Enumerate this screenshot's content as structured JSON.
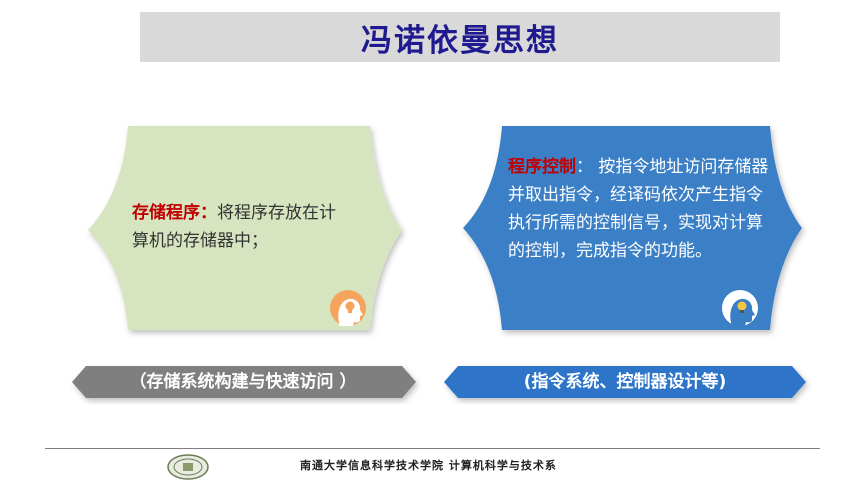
{
  "title": "冯诺依曼思想",
  "left_card": {
    "keyword": "存储程序",
    "colon": "：",
    "text": "将程序存放在计算机的存储器中；",
    "fill": "#d6e4bf",
    "icon": "idea-head-icon"
  },
  "right_card": {
    "keyword": "程序控制",
    "colon": "：",
    "text": " 按指令地址访问存储器并取出指令，经译码依次产生指令执行所需的控制信号，实现对计算的控制，完成指令的功能。",
    "fill": "#3a7fc6",
    "icon": "idea-head-icon"
  },
  "left_banner": {
    "label": "（存储系统构建与快速访问 ）",
    "fill": "#7f7f7f"
  },
  "right_banner": {
    "label": "(指令系统、控制器设计等)",
    "fill": "#2e75c9"
  },
  "footer": {
    "text": "南通大学信息科学技术学院  计算机科学与技术系",
    "logo": "university-logo"
  }
}
